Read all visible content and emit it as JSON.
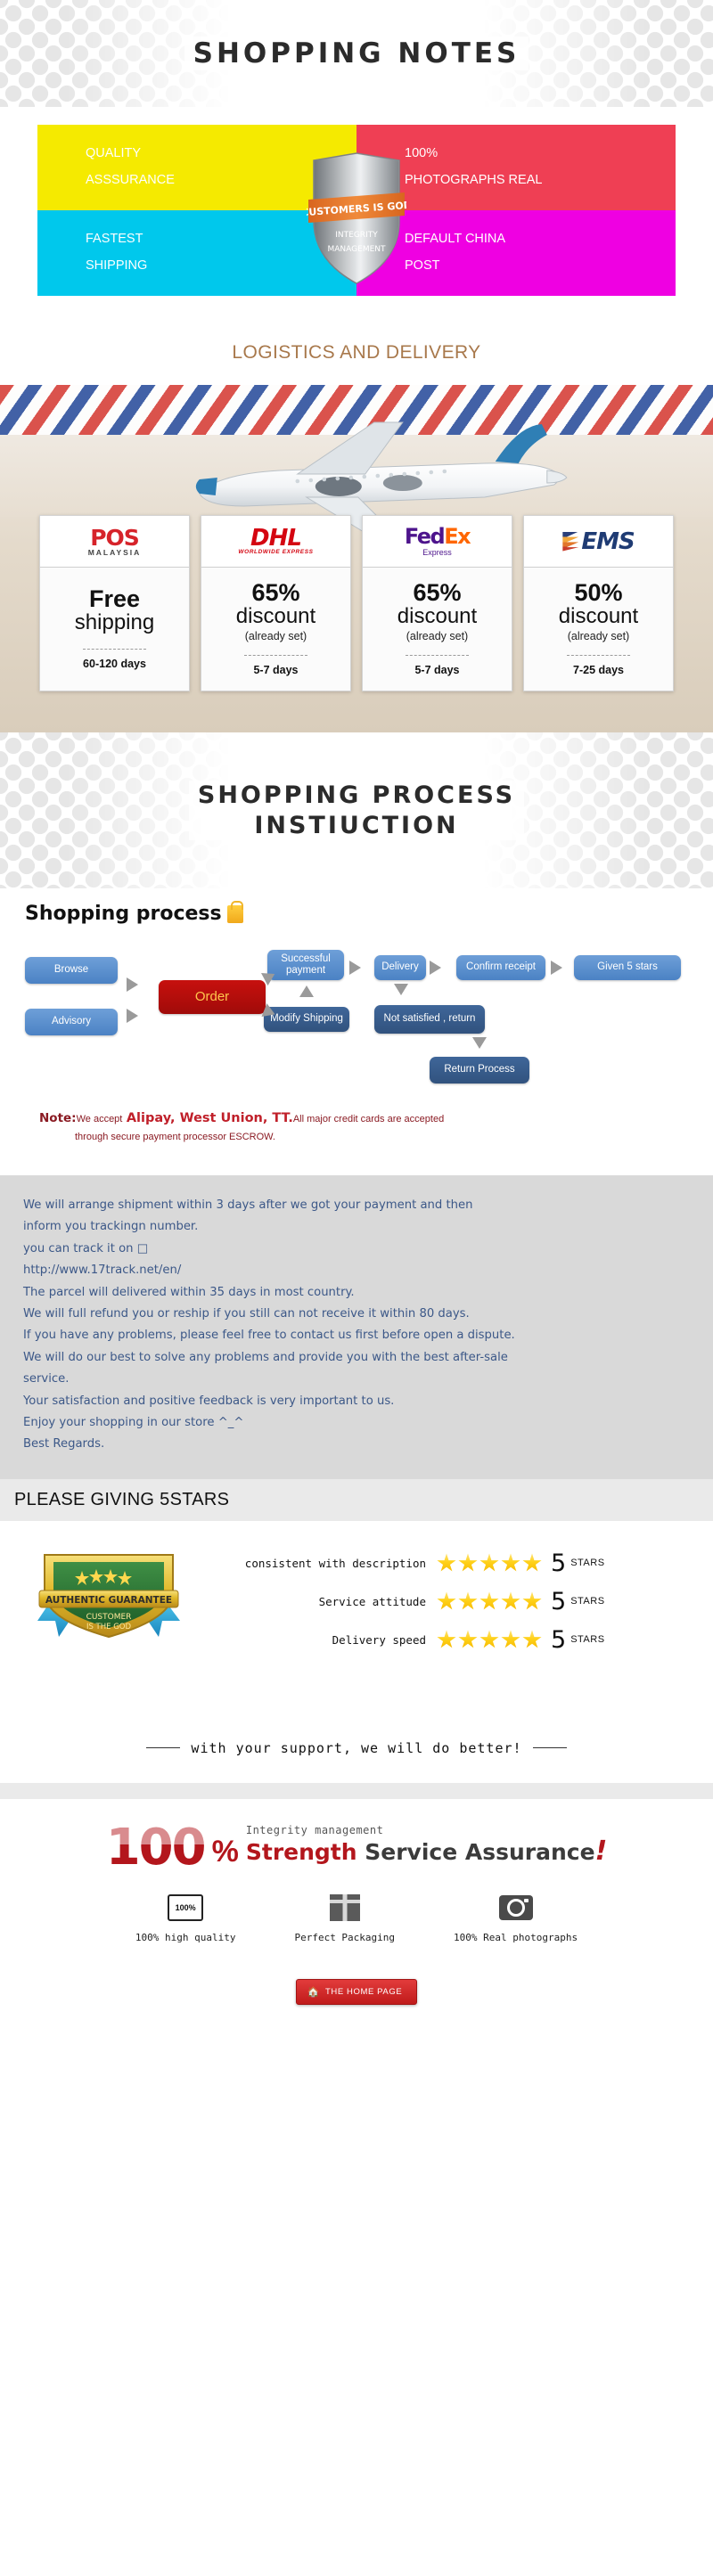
{
  "banners": {
    "shopping_notes": "SHOPPING  NOTES",
    "process_line1": "SHOPPING  PROCESS",
    "process_line2": "INSTIUCTION"
  },
  "quadrants": [
    {
      "line1": "QUALITY",
      "line2": "ASSSURANCE",
      "color": "#f5ea00"
    },
    {
      "line1": "100%",
      "line2": "PHOTOGRAPHS REAL",
      "color": "#ef3f54"
    },
    {
      "line1": "FASTEST",
      "line2": "SHIPPING",
      "color": "#00c8ec"
    },
    {
      "line1": "DEFAULT CHINA",
      "line2": "POST",
      "color": "#ef00e2"
    }
  ],
  "shield": {
    "banner_text": "CUSTOMERS  IS  GOD",
    "line1": "INTEGRITY",
    "line2": "MANAGEMENT"
  },
  "logistics": {
    "heading": "LOGISTICS AND DELIVERY",
    "carriers": [
      {
        "logo_name": "pos-malaysia-logo",
        "logo_main": "POS",
        "logo_sub": "MALAYSIA",
        "line1": "Free",
        "line2": "shipping",
        "note": "",
        "days": "60-120 days"
      },
      {
        "logo_name": "dhl-logo",
        "logo_main": "DHL",
        "logo_sub": "WORLDWIDE EXPRESS",
        "line1": "65%",
        "line2": "discount",
        "note": "(already set)",
        "days": "5-7 days"
      },
      {
        "logo_name": "fedex-logo",
        "logo_main_a": "Fed",
        "logo_main_b": "Ex",
        "logo_sub": "Express",
        "line1": "65%",
        "line2": "discount",
        "note": "(already set)",
        "days": "5-7 days"
      },
      {
        "logo_name": "ems-logo",
        "logo_main": "EMS",
        "logo_sub": "",
        "line1": "50%",
        "line2": "discount",
        "note": "(already set)",
        "days": "7-25 days"
      }
    ]
  },
  "flowchart": {
    "title": "Shopping process",
    "nodes": [
      {
        "id": "browse",
        "label": "Browse",
        "style": "light"
      },
      {
        "id": "advisory",
        "label": "Advisory",
        "style": "light"
      },
      {
        "id": "order",
        "label": "Order",
        "style": "order"
      },
      {
        "id": "successful",
        "label": "Successful\npayment",
        "style": "light"
      },
      {
        "id": "modify",
        "label": "Modify Shipping",
        "style": "dark"
      },
      {
        "id": "delivery",
        "label": "Delivery",
        "style": "light"
      },
      {
        "id": "notsat",
        "label": "Not satisfied , return",
        "style": "dark"
      },
      {
        "id": "confirm",
        "label": "Confirm receipt",
        "style": "light"
      },
      {
        "id": "given5",
        "label": "Given 5 stars",
        "style": "light"
      },
      {
        "id": "return",
        "label": "Return Process",
        "style": "dark"
      }
    ]
  },
  "note": {
    "lead": "Note:",
    "accept": "We accept",
    "methods": "Alipay, West Union, TT.",
    "tail": "All major credit cards are accepted",
    "line2": "through secure payment processor ESCROW."
  },
  "policy": {
    "lines": [
      "We will arrange shipment within 3 days after we got your payment and then",
      "inform you trackingn number.",
      "you can track it on □",
      "http://www.17track.net/en/",
      "The parcel will delivered within 35 days in most country.",
      "We will full refund you or reship if you still can not receive it within 80 days.",
      "If you have any problems, please feel free to contact us first before open a dispute.",
      "We will do our best to solve any problems and provide you with the best after-sale",
      "service.",
      "Your satisfaction and positive feedback is very important to us.",
      "Enjoy your shopping in our store ^_^",
      "Best Regards."
    ]
  },
  "stars": {
    "heading": "PLEASE GIVING 5STARS",
    "badge": {
      "title": "AUTHENTIC GUARANTEE",
      "sub1": "CUSTOMER",
      "sub2": "IS THE GOD"
    },
    "rows": [
      {
        "label": "consistent with description",
        "count": 5,
        "score": "5",
        "unit": "STARS"
      },
      {
        "label": "Service attitude",
        "count": 5,
        "score": "5",
        "unit": "STARS"
      },
      {
        "label": "Delivery speed",
        "count": 5,
        "score": "5",
        "unit": "STARS"
      }
    ],
    "support_text": "with your support, we will do better!"
  },
  "footer": {
    "big_number": "100",
    "percent": "%",
    "small_text": "Integrity management",
    "big_red": "Strength",
    "big_dark": "Service Assurance",
    "excl": "!",
    "badges": [
      {
        "icon": "quality-seal-icon",
        "seal_text": "100%",
        "caption": "100% high quality"
      },
      {
        "icon": "gift-box-icon",
        "seal_text": "",
        "caption": "Perfect Packaging"
      },
      {
        "icon": "camera-icon",
        "seal_text": "",
        "caption": "100% Real photographs"
      }
    ],
    "home_button": "THE HOME PAGE"
  }
}
